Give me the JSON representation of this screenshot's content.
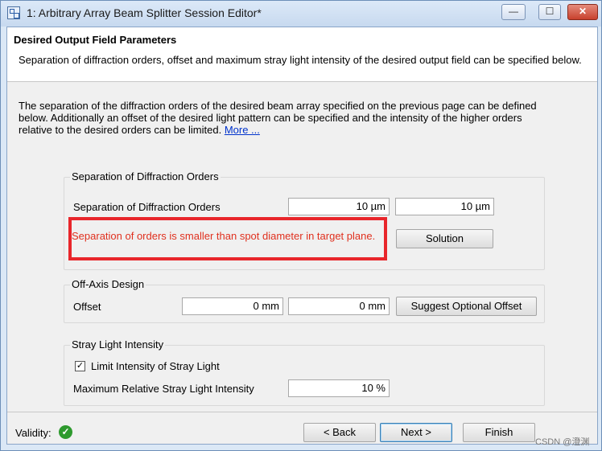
{
  "window": {
    "title": "1: Arbitrary Array Beam Splitter Session Editor*",
    "controls": {
      "minimize": "—",
      "maximize": "☐",
      "close": "✕"
    }
  },
  "header": {
    "title": "Desired Output Field Parameters",
    "description": "Separation of diffraction orders, offset and maximum stray light intensity of the desired output field can be specified below."
  },
  "intro": {
    "text": "The separation of the diffraction orders of the desired beam array specified on the previous page can be defined below. Additionally an offset of the desired light pattern can be specified and the intensity of the higher orders relative to the desired orders can be limited.",
    "link": "More ..."
  },
  "separation": {
    "group_label": "Separation of Diffraction Orders",
    "field_label": "Separation of Diffraction Orders",
    "value_x": "10 µm",
    "value_y": "10 µm",
    "error": "Separation of orders is smaller than spot diameter in target plane.",
    "solution_button": "Solution"
  },
  "offaxis": {
    "group_label": "Off-Axis Design",
    "field_label": "Offset",
    "value_x": "0 mm",
    "value_y": "0 mm",
    "suggest_button": "Suggest Optional Offset"
  },
  "stray": {
    "group_label": "Stray Light Intensity",
    "checkbox_label": "Limit Intensity of Stray Light",
    "checked_mark": "✓",
    "max_label": "Maximum Relative Stray Light Intensity",
    "max_value": "10 %"
  },
  "footer": {
    "validity_label": "Validity:",
    "validity_icon": "✓",
    "back": "< Back",
    "next": "Next >",
    "finish": "Finish"
  },
  "watermark": "CSDN @澄渊",
  "colors": {
    "error": "#e0301e",
    "highlight": "#e8262b",
    "valid": "#2e9a2e",
    "link": "#0033cc"
  }
}
